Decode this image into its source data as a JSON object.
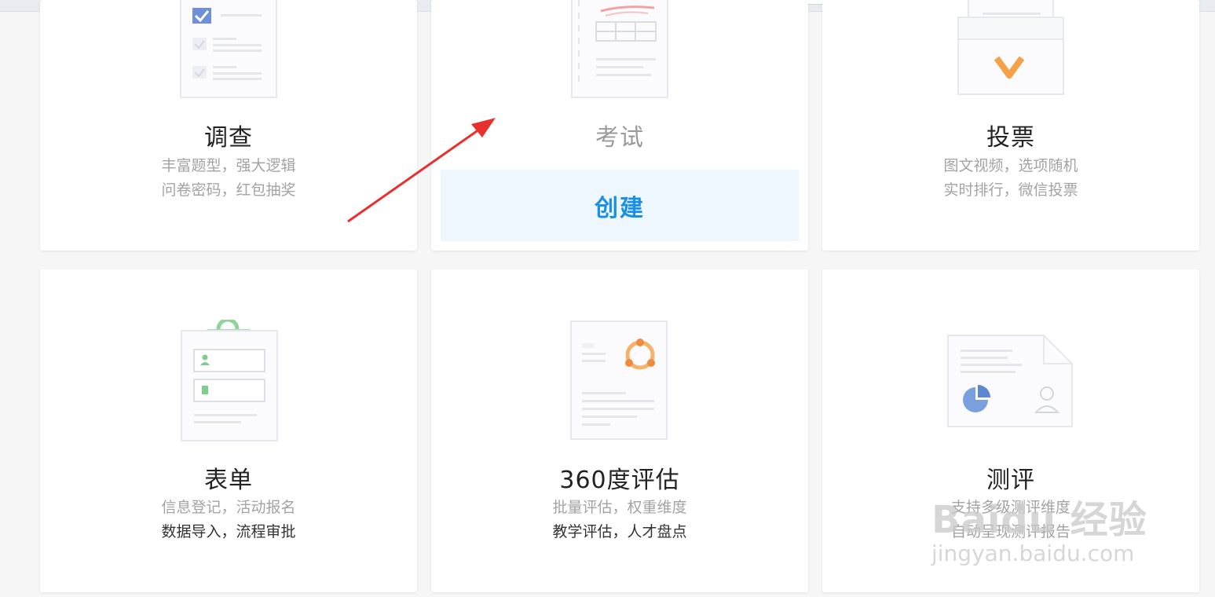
{
  "cards": [
    {
      "title": "调查",
      "desc1": "丰富题型，强大逻辑",
      "desc2": "问卷密码，红包抽奖"
    },
    {
      "title": "考试",
      "create_label": "创建"
    },
    {
      "title": "投票",
      "desc1": "图文视频，选项随机",
      "desc2": "实时排行，微信投票"
    },
    {
      "title": "表单",
      "desc1": "信息登记，活动报名",
      "desc2": "数据导入，流程审批"
    },
    {
      "title": "360度评估",
      "desc1": "批量评估，权重维度",
      "desc2": "教学评估，人才盘点"
    },
    {
      "title": "测评",
      "desc1": "支持多级测评维度",
      "desc2": "自动呈现测评报告"
    }
  ],
  "watermark": {
    "logo": "Baidu 经验",
    "url": "jingyan.baidu.com"
  },
  "colors": {
    "accent_blue": "#1a8fe8",
    "create_bg": "#eff7fe",
    "arrow_red": "#e8312f",
    "green_button": "#5fb636"
  },
  "icons": [
    "survey-checklist-icon",
    "exam-paper-icon",
    "vote-box-icon",
    "form-clipboard-icon",
    "evaluation-360-icon",
    "assessment-report-icon"
  ]
}
